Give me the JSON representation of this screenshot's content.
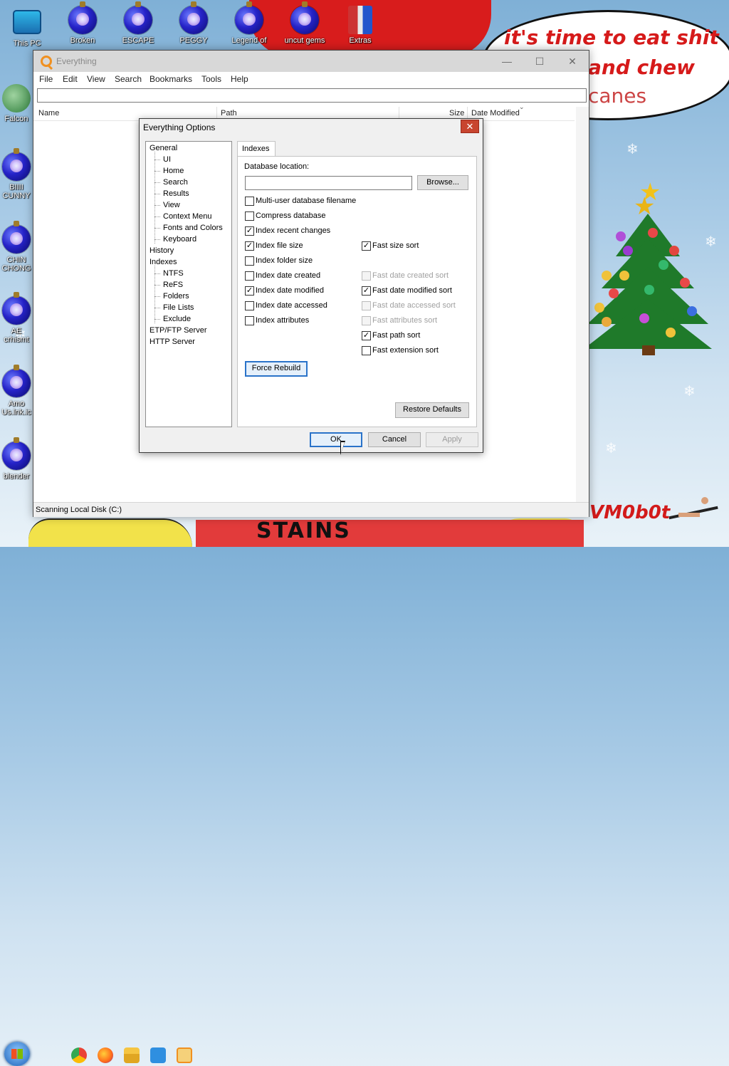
{
  "desktop": {
    "icons": [
      {
        "label": "This PC",
        "kind": "monitor-icon"
      },
      {
        "label": "Broken",
        "kind": "ornament-icon"
      },
      {
        "label": "ESCAPE",
        "kind": "ornament-icon"
      },
      {
        "label": "PEGGY",
        "kind": "ornament-icon"
      },
      {
        "label": "Legend of",
        "kind": "ornament-icon"
      },
      {
        "label": "uncut gems",
        "kind": "ornament-icon"
      },
      {
        "label": "Extras",
        "kind": "extras-icon"
      },
      {
        "label": "Falcon",
        "kind": "falcon-icon"
      },
      {
        "label": "BIIII CUNNY",
        "kind": "ornament-icon"
      },
      {
        "label": "CHIN CHONG",
        "kind": "ornament-icon"
      },
      {
        "label": "AE crhismt",
        "kind": "ornament-icon"
      },
      {
        "label": "Amo Us.lnk.ic",
        "kind": "ornament-icon"
      },
      {
        "label": "blender",
        "kind": "ornament-icon"
      }
    ],
    "bubble_lines": [
      "it's time to eat shit",
      "and chew",
      "canes"
    ],
    "signature": "VM0b0t",
    "santa_text": "STAINS",
    "colors": {
      "bubble_text": "#d61a1a",
      "santa_red": "#d81c1c",
      "tree_green": "#1f7a2a"
    }
  },
  "taskbar": {
    "icons": [
      "start-orb-icon",
      "chrome-icon",
      "firefox-icon",
      "file-explorer-icon",
      "notepad-icon",
      "everything-search-icon"
    ]
  },
  "everything": {
    "title": "Everything",
    "menu": [
      "File",
      "Edit",
      "View",
      "Search",
      "Bookmarks",
      "Tools",
      "Help"
    ],
    "search_value": "",
    "columns": {
      "name": "Name",
      "path": "Path",
      "size": "Size",
      "date_modified": "Date Modified"
    },
    "status": "Scanning Local Disk (C:)"
  },
  "options": {
    "title": "Everything Options",
    "close_glyph": "✕",
    "tree": [
      {
        "label": "General",
        "level": 0
      },
      {
        "label": "UI",
        "level": 1
      },
      {
        "label": "Home",
        "level": 1
      },
      {
        "label": "Search",
        "level": 1
      },
      {
        "label": "Results",
        "level": 1
      },
      {
        "label": "View",
        "level": 1
      },
      {
        "label": "Context Menu",
        "level": 1
      },
      {
        "label": "Fonts and Colors",
        "level": 1
      },
      {
        "label": "Keyboard",
        "level": 1
      },
      {
        "label": "History",
        "level": 0
      },
      {
        "label": "Indexes",
        "level": 0,
        "selected": true
      },
      {
        "label": "NTFS",
        "level": 1
      },
      {
        "label": "ReFS",
        "level": 1
      },
      {
        "label": "Folders",
        "level": 1
      },
      {
        "label": "File Lists",
        "level": 1
      },
      {
        "label": "Exclude",
        "level": 1
      },
      {
        "label": "ETP/FTP Server",
        "level": 0
      },
      {
        "label": "HTTP Server",
        "level": 0
      }
    ],
    "tab": "Indexes",
    "db_location_label": "Database location:",
    "db_location_value": "",
    "browse": "Browse...",
    "checkboxes_left": [
      {
        "label": "Multi-user database filename",
        "checked": false
      },
      {
        "label": "Compress database",
        "checked": false
      },
      {
        "label": "Index recent changes",
        "checked": true
      },
      {
        "label": "Index file size",
        "checked": true
      },
      {
        "label": "Index folder size",
        "checked": false
      },
      {
        "label": "Index date created",
        "checked": false
      },
      {
        "label": "Index date modified",
        "checked": true
      },
      {
        "label": "Index date accessed",
        "checked": false
      },
      {
        "label": "Index attributes",
        "checked": false
      }
    ],
    "checkboxes_right": [
      {
        "label": "Fast size sort",
        "checked": true,
        "disabled": false
      },
      {
        "label": "Fast date created sort",
        "checked": false,
        "disabled": true
      },
      {
        "label": "Fast date modified sort",
        "checked": true,
        "disabled": false
      },
      {
        "label": "Fast date accessed sort",
        "checked": false,
        "disabled": true
      },
      {
        "label": "Fast attributes sort",
        "checked": false,
        "disabled": true
      },
      {
        "label": "Fast path sort",
        "checked": true,
        "disabled": false
      },
      {
        "label": "Fast extension sort",
        "checked": false,
        "disabled": false
      }
    ],
    "force_rebuild": "Force Rebuild",
    "restore_defaults": "Restore Defaults",
    "ok": "OK",
    "cancel": "Cancel",
    "apply": "Apply"
  }
}
